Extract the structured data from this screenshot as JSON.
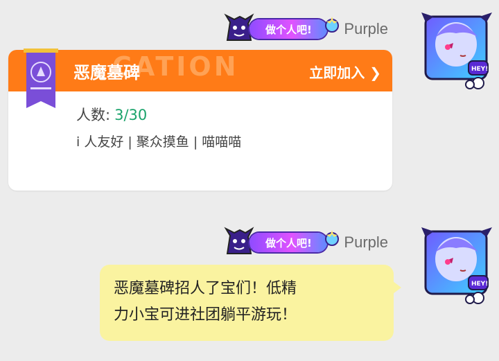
{
  "messages": [
    {
      "sender": "Purple",
      "badge_text": "做个人吧!",
      "card": {
        "watermark": "CATION",
        "title": "恶魔墓碑",
        "join_label": "立即加入",
        "members_label": "人数:",
        "members_value": "3/30",
        "tags": "i 人友好 | 聚众摸鱼 | 喵喵喵"
      }
    },
    {
      "sender": "Purple",
      "badge_text": "做个人吧!",
      "text_line1": "恶魔墓碑招人了宝们！低精",
      "text_line2": "力小宝可进社团躺平游玩！"
    }
  ],
  "avatar_icon": "demon-girl-avatar-icon",
  "colors": {
    "card_header": "#ff7b17",
    "members_value": "#1aa36b",
    "bubble": "#faf3a0"
  }
}
